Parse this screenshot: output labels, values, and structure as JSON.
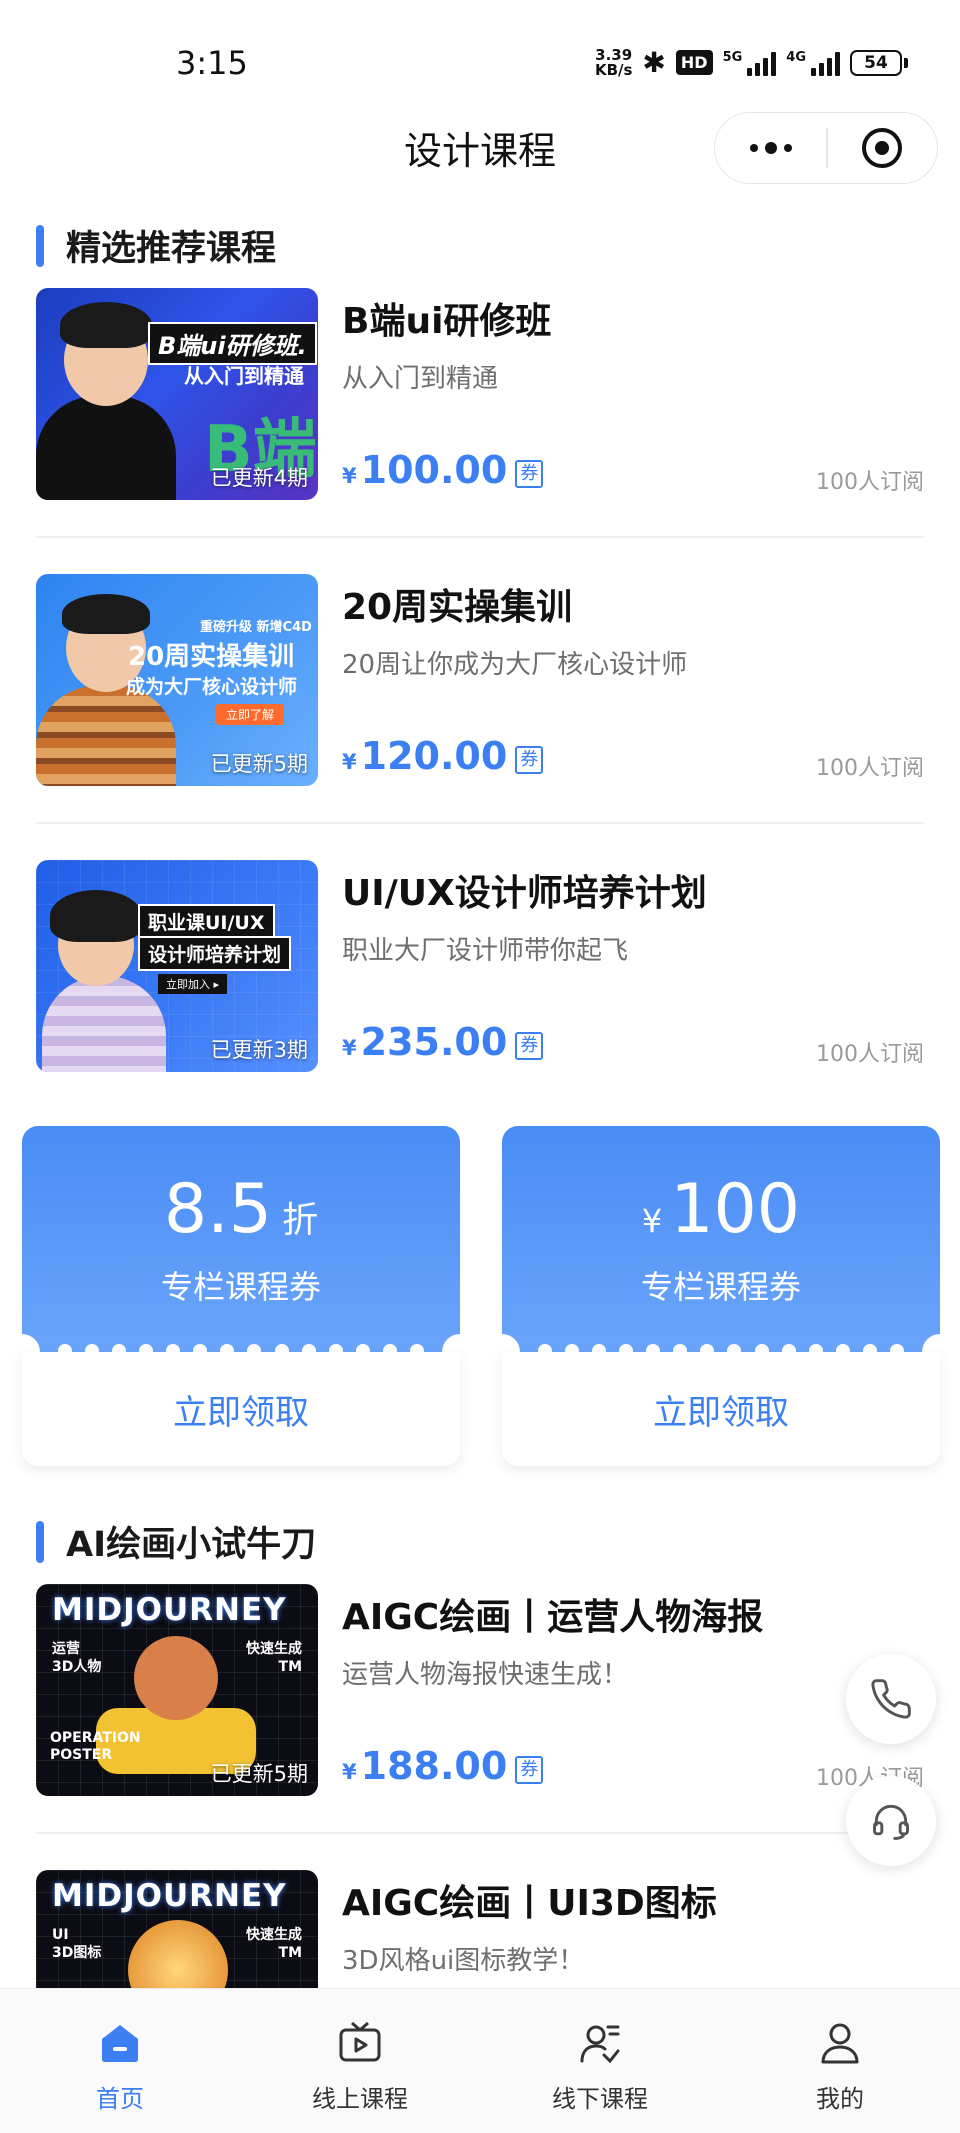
{
  "status_bar": {
    "time": "3:15",
    "net_speed_value": "3.39",
    "net_speed_unit": "KB/s",
    "hd_badge": "HD",
    "signal_1": "5G",
    "signal_2": "4G",
    "battery": "54"
  },
  "nav": {
    "title": "设计课程"
  },
  "section_featured": {
    "title": "精选推荐课程"
  },
  "courses_featured": [
    {
      "title": "B端ui研修班",
      "subtitle": "从入门到精通",
      "currency": "¥",
      "price": "100.00",
      "coupon_tag": "券",
      "subscribers": "100人订阅",
      "update_badge": "已更新4期",
      "thumb_title": "B端ui研修班.",
      "thumb_sub": "从入门到精通"
    },
    {
      "title": "20周实操集训",
      "subtitle": "20周让你成为大厂核心设计师",
      "currency": "¥",
      "price": "120.00",
      "coupon_tag": "券",
      "subscribers": "100人订阅",
      "update_badge": "已更新5期",
      "thumb_top": "重磅升级 新增C4D",
      "thumb_title": "20周实操集训",
      "thumb_sub": "成为大厂核心设计师",
      "thumb_btn": "立即了解"
    },
    {
      "title": "UI/UX设计师培养计划",
      "subtitle": "职业大厂设计师带你起飞",
      "currency": "¥",
      "price": "235.00",
      "coupon_tag": "券",
      "subscribers": "100人订阅",
      "update_badge": "已更新3期",
      "thumb_title": "职业课UI/UX",
      "thumb_sub": "设计师培养计划",
      "thumb_btn": "立即加入 ▸"
    }
  ],
  "coupons": [
    {
      "value": "8.5",
      "unit": "折",
      "desc": "专栏课程券",
      "button": "立即领取"
    },
    {
      "currency": "¥",
      "value": "100",
      "desc": "专栏课程券",
      "button": "立即领取"
    }
  ],
  "section_ai": {
    "title": "AI绘画小试牛刀"
  },
  "courses_ai": [
    {
      "title": "AIGC绘画丨运营人物海报",
      "subtitle": "运营人物海报快速生成！",
      "currency": "¥",
      "price": "188.00",
      "coupon_tag": "券",
      "subscribers": "100人订阅",
      "update_badge": "已更新5期",
      "thumb_brand": "MIDJOURNEY",
      "thumb_left": "运营\n3D人物",
      "thumb_right": "快速生成\nTM",
      "thumb_bottom": "OPERATION\nPOSTER"
    },
    {
      "title": "AIGC绘画丨UI3D图标",
      "subtitle": "3D风格ui图标教学！",
      "thumb_brand": "MIDJOURNEY",
      "thumb_left": "UI\n3D图标",
      "thumb_right": "快速生成\nTM"
    }
  ],
  "tabbar": [
    {
      "label": "首页",
      "icon": "home-icon",
      "active": true
    },
    {
      "label": "线上课程",
      "icon": "tv-play-icon",
      "active": false
    },
    {
      "label": "线下课程",
      "icon": "offline-course-icon",
      "active": false
    },
    {
      "label": "我的",
      "icon": "user-icon",
      "active": false
    }
  ],
  "colors": {
    "accent": "#3b7ff2",
    "coupon_top": "#4a8cf6",
    "muted_text": "#9a9a9a"
  }
}
